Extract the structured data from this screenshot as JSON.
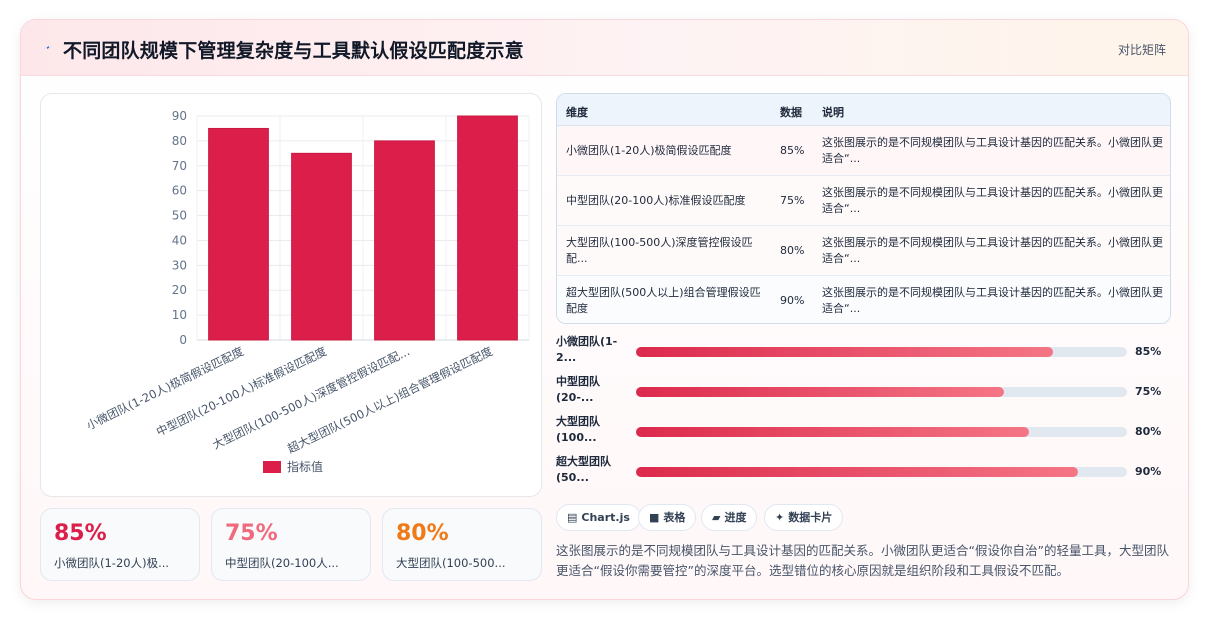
{
  "header": {
    "title": "不同团队规模下管理复杂度与工具默认假设匹配度示意",
    "tag": "对比矩阵"
  },
  "colors": {
    "primary": "#dc1e4b",
    "accent_pink": "#f47585",
    "accent_orange": "#f07a18"
  },
  "chart_data": {
    "type": "bar",
    "categories": [
      "小微团队(1-20人)极简假设匹配度",
      "中型团队(20-100人)标准假设匹配度",
      "大型团队(100-500人)深度管控假设匹配...",
      "超大型团队(500人以上)组合管理假设匹配度"
    ],
    "series": [
      {
        "name": "指标值",
        "values": [
          85,
          75,
          80,
          90
        ]
      }
    ],
    "ylim": [
      0,
      90
    ],
    "yticks": [
      "0",
      "10",
      "20",
      "30",
      "40",
      "50",
      "60",
      "70",
      "80",
      "90"
    ],
    "legend_position": "bottom",
    "grid": true
  },
  "stats": [
    {
      "value": "85%",
      "label": "小微团队(1-20人)极..."
    },
    {
      "value": "75%",
      "label": "中型团队(20-100人..."
    },
    {
      "value": "80%",
      "label": "大型团队(100-500..."
    }
  ],
  "table": {
    "headers": [
      "维度",
      "数据",
      "说明"
    ],
    "rows": [
      {
        "dim": "小微团队(1-20人)极简假设匹配度",
        "val": "85%",
        "desc": "这张图展示的是不同规模团队与工具设计基因的匹配关系。小微团队更适合“..."
      },
      {
        "dim": "中型团队(20-100人)标准假设匹配度",
        "val": "75%",
        "desc": "这张图展示的是不同规模团队与工具设计基因的匹配关系。小微团队更适合“..."
      },
      {
        "dim": "大型团队(100-500人)深度管控假设匹配...",
        "val": "80%",
        "desc": "这张图展示的是不同规模团队与工具设计基因的匹配关系。小微团队更适合“..."
      },
      {
        "dim": "超大型团队(500人以上)组合管理假设匹配度",
        "val": "90%",
        "desc": "这张图展示的是不同规模团队与工具设计基因的匹配关系。小微团队更适合“..."
      }
    ]
  },
  "progress": [
    {
      "label": "小微团队(1-2...",
      "value": 0.85,
      "text": "85%"
    },
    {
      "label": "中型团队(20-...",
      "value": 0.75,
      "text": "75%"
    },
    {
      "label": "大型团队(100...",
      "value": 0.8,
      "text": "80%"
    },
    {
      "label": "超大型团队(50...",
      "value": 0.9,
      "text": "90%"
    }
  ],
  "chips": [
    {
      "icon": "chart-icon",
      "label": "Chart.js"
    },
    {
      "icon": "table-icon",
      "label": "表格"
    },
    {
      "icon": "progress-icon",
      "label": "进度"
    },
    {
      "icon": "sparkle-icon",
      "label": "数据卡片"
    }
  ],
  "summary": "这张图展示的是不同规模团队与工具设计基因的匹配关系。小微团队更适合“假设你自治”的轻量工具，大型团队更适合“假设你需要管控”的深度平台。选型错位的核心原因就是组织阶段和工具假设不匹配。"
}
